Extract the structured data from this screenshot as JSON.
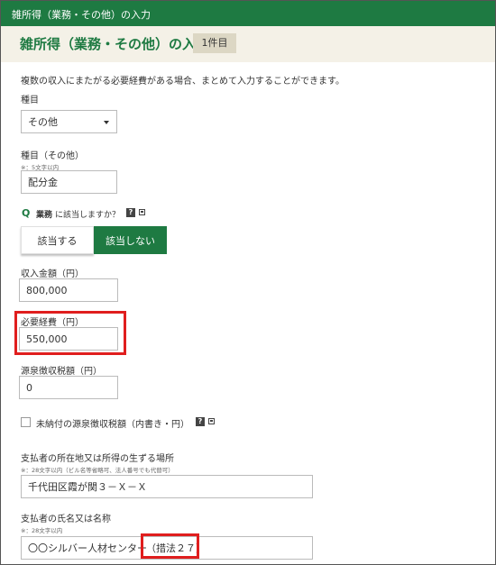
{
  "header": {
    "title": "雑所得（業務・その他）の入力"
  },
  "page": {
    "title": "雑所得（業務・その他）の入力",
    "count_badge": "1件目"
  },
  "intro": "複数の収入にまたがる必要経費がある場合、まとめて入力することができます。",
  "category": {
    "label": "種目",
    "value": "その他"
  },
  "category_other": {
    "label": "種目（その他）",
    "note": "※：5文字以内",
    "value": "配分金"
  },
  "business_question": {
    "q": "Q",
    "bold": "業務",
    "rest": "に該当しますか？",
    "help": "?",
    "yes_label": "該当する",
    "no_label": "該当しない",
    "selected": "該当しない"
  },
  "income": {
    "label": "収入金額（円）",
    "value": "800,000"
  },
  "expenses": {
    "label": "必要経費（円）",
    "value": "550,000"
  },
  "withholding": {
    "label": "源泉徴収税額（円）",
    "value": "0"
  },
  "unpaid_withholding": {
    "label": "未納付の源泉徴収税額（内書き・円）",
    "help": "?",
    "checked": false
  },
  "payer_address": {
    "label": "支払者の所在地又は所得の生ずる場所",
    "note": "※：28文字以内（ビル名等省略可、法人番号でも代替可）",
    "value": "千代田区霞が関３－Ｘ－Ｘ"
  },
  "payer_name": {
    "label": "支払者の氏名又は名称",
    "note": "※：28文字以内",
    "value": "〇〇シルバー人材センター",
    "annotation": "（措法２７）"
  },
  "colors": {
    "brand_green": "#1e7a42",
    "title_bg": "#f4f1e7",
    "badge_bg": "#dcd7c4",
    "highlight_red": "#e01e1e"
  }
}
